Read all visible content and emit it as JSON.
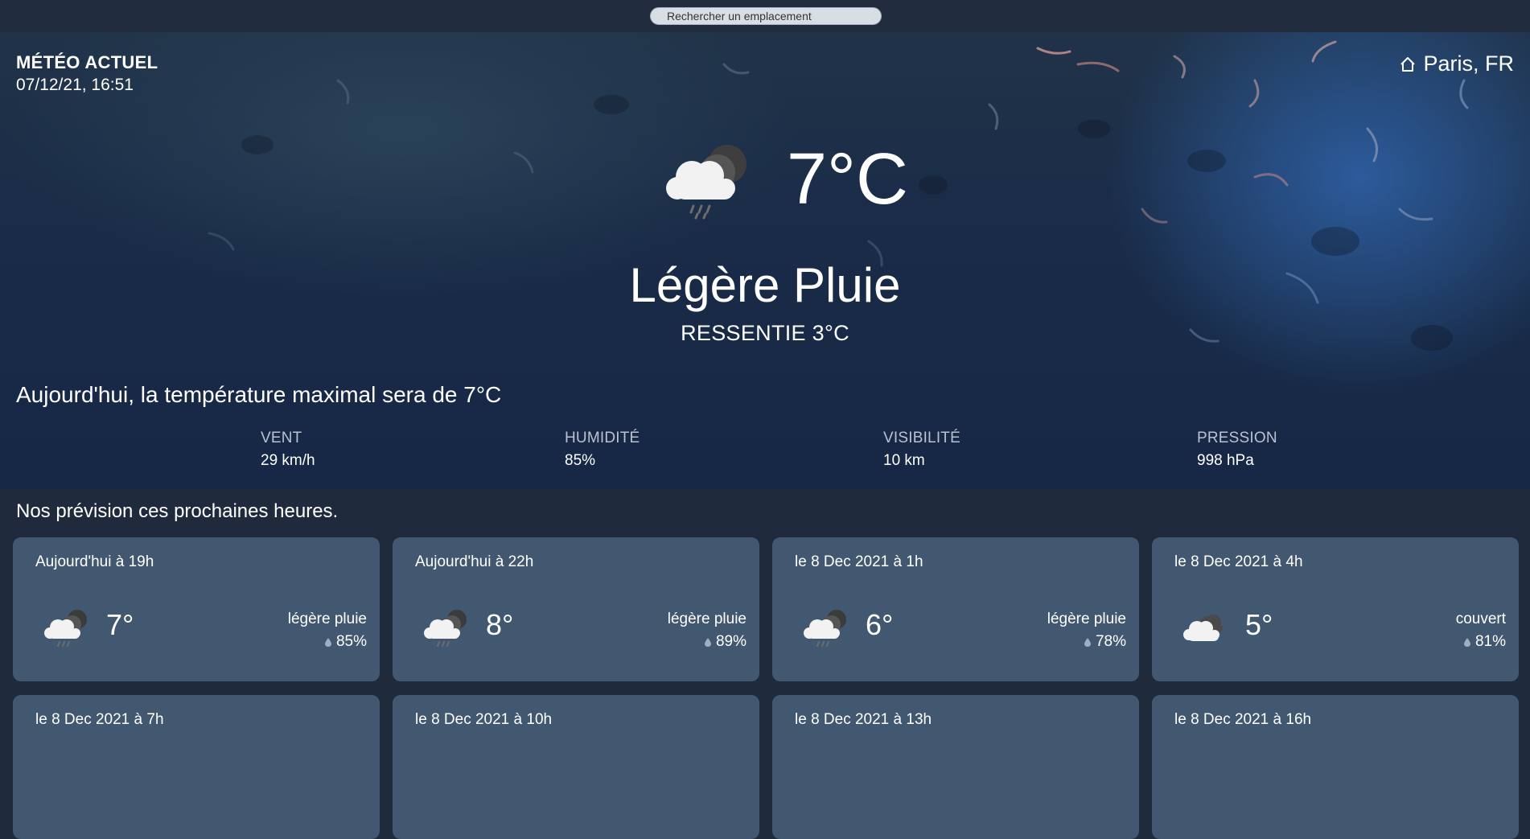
{
  "search": {
    "placeholder": "Rechercher un emplacement"
  },
  "current": {
    "title": "MÉTÉO ACTUEL",
    "datetime": "07/12/21, 16:51",
    "location": "Paris, FR",
    "temperature": "7°C",
    "condition": "Légère Pluie",
    "feels_like": "RESSENTIE 3°C",
    "icon": "cloud-rain-moon-icon",
    "today_note": "Aujourd'hui, la température maximal sera de 7°C",
    "stats": [
      {
        "label": "VENT",
        "value": "29 km/h"
      },
      {
        "label": "HUMIDITÉ",
        "value": "85%"
      },
      {
        "label": "VISIBILITÉ",
        "value": "10 km"
      },
      {
        "label": "PRESSION",
        "value": "998 hPa"
      }
    ]
  },
  "forecast": {
    "title": "Nos prévision ces prochaines heures.",
    "cards": [
      {
        "when": "Aujourd'hui à 19h",
        "temp": "7°",
        "desc": "légère pluie",
        "humidity": "85%",
        "icon": "cloud-rain-moon-icon"
      },
      {
        "when": "Aujourd'hui à 22h",
        "temp": "8°",
        "desc": "légère pluie",
        "humidity": "89%",
        "icon": "cloud-rain-moon-icon"
      },
      {
        "when": "le 8 Dec 2021 à 1h",
        "temp": "6°",
        "desc": "légère pluie",
        "humidity": "78%",
        "icon": "cloud-rain-moon-icon"
      },
      {
        "when": "le 8 Dec 2021 à 4h",
        "temp": "5°",
        "desc": "couvert",
        "humidity": "81%",
        "icon": "overcast-cloud-icon"
      },
      {
        "when": "le 8 Dec 2021 à 7h"
      },
      {
        "when": "le 8 Dec 2021 à 10h"
      },
      {
        "when": "le 8 Dec 2021 à 13h"
      },
      {
        "when": "le 8 Dec 2021 à 16h"
      }
    ]
  }
}
